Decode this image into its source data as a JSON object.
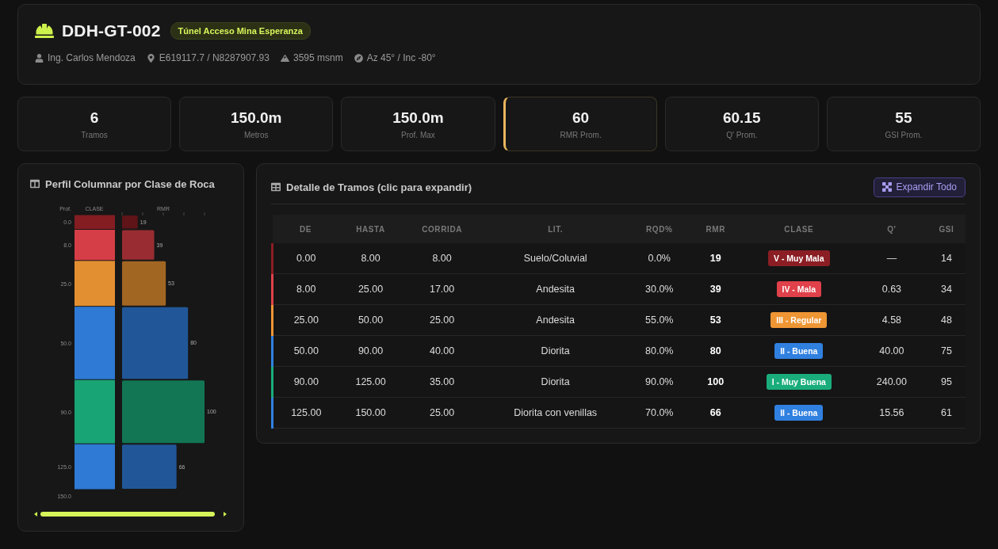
{
  "header": {
    "title": "DDH-GT-002",
    "tag": "Túnel Acceso Mina Esperanza",
    "meta": [
      {
        "kind": "person",
        "text": "Ing. Carlos Mendoza"
      },
      {
        "kind": "location",
        "text": "E619117.7 / N8287907.93"
      },
      {
        "kind": "elevation",
        "text": "3595 msnm"
      },
      {
        "kind": "orientation",
        "text": "Az 45° / Inc -80°"
      }
    ]
  },
  "stats": [
    {
      "value": "6",
      "label": "Tramos",
      "highlighted": false
    },
    {
      "value": "150.0m",
      "label": "Metros",
      "highlighted": false
    },
    {
      "value": "150.0m",
      "label": "Prof. Max",
      "highlighted": false
    },
    {
      "value": "60",
      "label": "RMR Prom.",
      "highlighted": true
    },
    {
      "value": "60.15",
      "label": "Q' Prom.",
      "highlighted": false
    },
    {
      "value": "55",
      "label": "GSI Prom.",
      "highlighted": false
    }
  ],
  "profile": {
    "title": "Perfil Columnar por Clase de Roca",
    "class_header": "CLASE",
    "chart_data": {
      "type": "bar",
      "orientation": "horizontal",
      "xlabel": "RMR",
      "ylabel": "Prof.",
      "categories": [
        "0.0",
        "8.0",
        "25.0",
        "50.0",
        "90.0",
        "125.0"
      ],
      "values": [
        19,
        39,
        53,
        80,
        100,
        66
      ],
      "xlim": [
        0,
        100
      ],
      "data_labels": true,
      "annotations": [
        "150.0"
      ]
    }
  },
  "table_panel": {
    "title": "Detalle de Tramos (clic para expandir)",
    "expand_button": "Expandir Todo",
    "columns": [
      "DE",
      "HASTA",
      "CORRIDA",
      "LIT.",
      "RQD%",
      "RMR",
      "CLASE",
      "Q'",
      "GSI"
    ],
    "rows": [
      {
        "de": "0.00",
        "hasta": "8.00",
        "corrida": "8.00",
        "lit": "Suelo/Coluvial",
        "rqd": "0.0%",
        "rmr": "19",
        "clase": "V - Muy Mala",
        "q": "—",
        "gsi": "14",
        "color": "#8b1e24"
      },
      {
        "de": "8.00",
        "hasta": "25.00",
        "corrida": "17.00",
        "lit": "Andesita",
        "rqd": "30.0%",
        "rmr": "39",
        "clase": "IV - Mala",
        "q": "0.63",
        "gsi": "34",
        "color": "#e0414a"
      },
      {
        "de": "25.00",
        "hasta": "50.00",
        "corrida": "25.00",
        "lit": "Andesita",
        "rqd": "55.0%",
        "rmr": "53",
        "clase": "III - Regular",
        "q": "4.58",
        "gsi": "48",
        "color": "#ee9634"
      },
      {
        "de": "50.00",
        "hasta": "90.00",
        "corrida": "40.00",
        "lit": "Diorita",
        "rqd": "80.0%",
        "rmr": "80",
        "clase": "II - Buena",
        "q": "40.00",
        "gsi": "75",
        "color": "#3080e0"
      },
      {
        "de": "90.00",
        "hasta": "125.00",
        "corrida": "35.00",
        "lit": "Diorita",
        "rqd": "90.0%",
        "rmr": "100",
        "clase": "I - Muy Buena",
        "q": "240.00",
        "gsi": "95",
        "color": "#1aad7b"
      },
      {
        "de": "125.00",
        "hasta": "150.00",
        "corrida": "25.00",
        "lit": "Diorita con venillas",
        "rqd": "70.0%",
        "rmr": "66",
        "clase": "II - Buena",
        "q": "15.56",
        "gsi": "61",
        "color": "#3080e0"
      }
    ]
  }
}
